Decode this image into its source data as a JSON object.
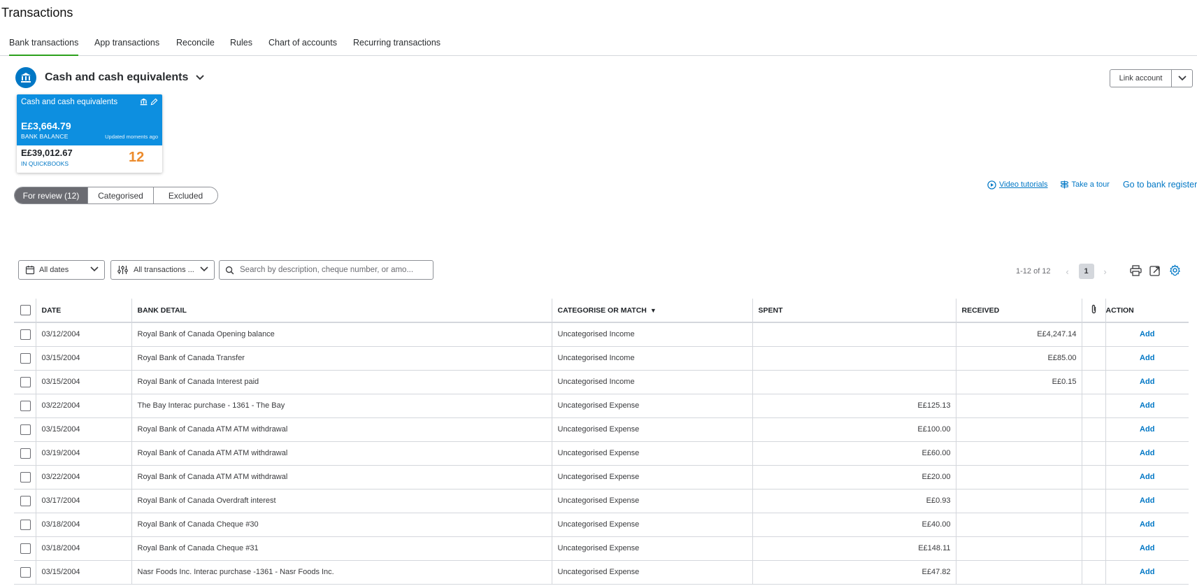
{
  "page": {
    "title": "Transactions"
  },
  "tabs": [
    {
      "label": "Bank transactions",
      "active": true
    },
    {
      "label": "App transactions"
    },
    {
      "label": "Reconcile"
    },
    {
      "label": "Rules"
    },
    {
      "label": "Chart of accounts"
    },
    {
      "label": "Recurring transactions"
    }
  ],
  "account": {
    "name": "Cash and cash equivalents",
    "link_button": "Link account"
  },
  "card": {
    "title": "Cash and cash equivalents",
    "bank_balance": "E£3,664.79",
    "bank_balance_label": "BANK BALANCE",
    "updated": "Updated moments ago",
    "qb_balance": "E£39,012.67",
    "qb_label": "IN QUICKBOOKS",
    "review_count": "12"
  },
  "segments": [
    "For review (12)",
    "Categorised",
    "Excluded"
  ],
  "help_links": {
    "video": "Video tutorials",
    "tour": "Take a tour",
    "register": "Go to bank register"
  },
  "filters": {
    "dates": "All dates",
    "transactions": "All transactions ...",
    "search_placeholder": "Search by description, cheque number, or amo..."
  },
  "pager": {
    "range": "1-12 of 12",
    "page": "1"
  },
  "table": {
    "headers": {
      "date": "DATE",
      "bank_detail": "BANK DETAIL",
      "categorise": "CATEGORISE OR MATCH",
      "spent": "SPENT",
      "received": "RECEIVED",
      "action": "ACTION"
    },
    "rows": [
      {
        "date": "03/12/2004",
        "detail": "Royal Bank of Canada Opening balance",
        "category": "Uncategorised Income",
        "spent": "",
        "received": "E£4,247.14",
        "action": "Add"
      },
      {
        "date": "03/15/2004",
        "detail": "Royal Bank of Canada Transfer",
        "category": "Uncategorised Income",
        "spent": "",
        "received": "E£85.00",
        "action": "Add"
      },
      {
        "date": "03/15/2004",
        "detail": "Royal Bank of Canada Interest paid",
        "category": "Uncategorised Income",
        "spent": "",
        "received": "E£0.15",
        "action": "Add"
      },
      {
        "date": "03/22/2004",
        "detail": "The Bay Interac purchase - 1361 - The Bay",
        "category": "Uncategorised Expense",
        "spent": "E£125.13",
        "received": "",
        "action": "Add"
      },
      {
        "date": "03/15/2004",
        "detail": "Royal Bank of Canada ATM ATM withdrawal",
        "category": "Uncategorised Expense",
        "spent": "E£100.00",
        "received": "",
        "action": "Add"
      },
      {
        "date": "03/19/2004",
        "detail": "Royal Bank of Canada ATM ATM withdrawal",
        "category": "Uncategorised Expense",
        "spent": "E£60.00",
        "received": "",
        "action": "Add"
      },
      {
        "date": "03/22/2004",
        "detail": "Royal Bank of Canada ATM ATM withdrawal",
        "category": "Uncategorised Expense",
        "spent": "E£20.00",
        "received": "",
        "action": "Add"
      },
      {
        "date": "03/17/2004",
        "detail": "Royal Bank of Canada Overdraft interest",
        "category": "Uncategorised Expense",
        "spent": "E£0.93",
        "received": "",
        "action": "Add"
      },
      {
        "date": "03/18/2004",
        "detail": "Royal Bank of Canada Cheque #30",
        "category": "Uncategorised Expense",
        "spent": "E£40.00",
        "received": "",
        "action": "Add"
      },
      {
        "date": "03/18/2004",
        "detail": "Royal Bank of Canada Cheque #31",
        "category": "Uncategorised Expense",
        "spent": "E£148.11",
        "received": "",
        "action": "Add"
      },
      {
        "date": "03/15/2004",
        "detail": "Nasr Foods Inc. Interac purchase -1361 - Nasr Foods Inc.",
        "category": "Uncategorised Expense",
        "spent": "E£47.82",
        "received": "",
        "action": "Add"
      }
    ]
  },
  "colors": {
    "brand_blue": "#0077c5",
    "card_blue": "#0d8fe0",
    "active_tab": "#2ca01c",
    "count_orange": "#ec8b2c"
  },
  "icons": [
    "bank-icon",
    "chevron-down-icon",
    "edit-pencil-icon",
    "play-circle-icon",
    "signpost-icon",
    "calendar-icon",
    "sliders-icon",
    "search-icon",
    "print-icon",
    "export-icon",
    "gear-icon",
    "paperclip-icon"
  ]
}
